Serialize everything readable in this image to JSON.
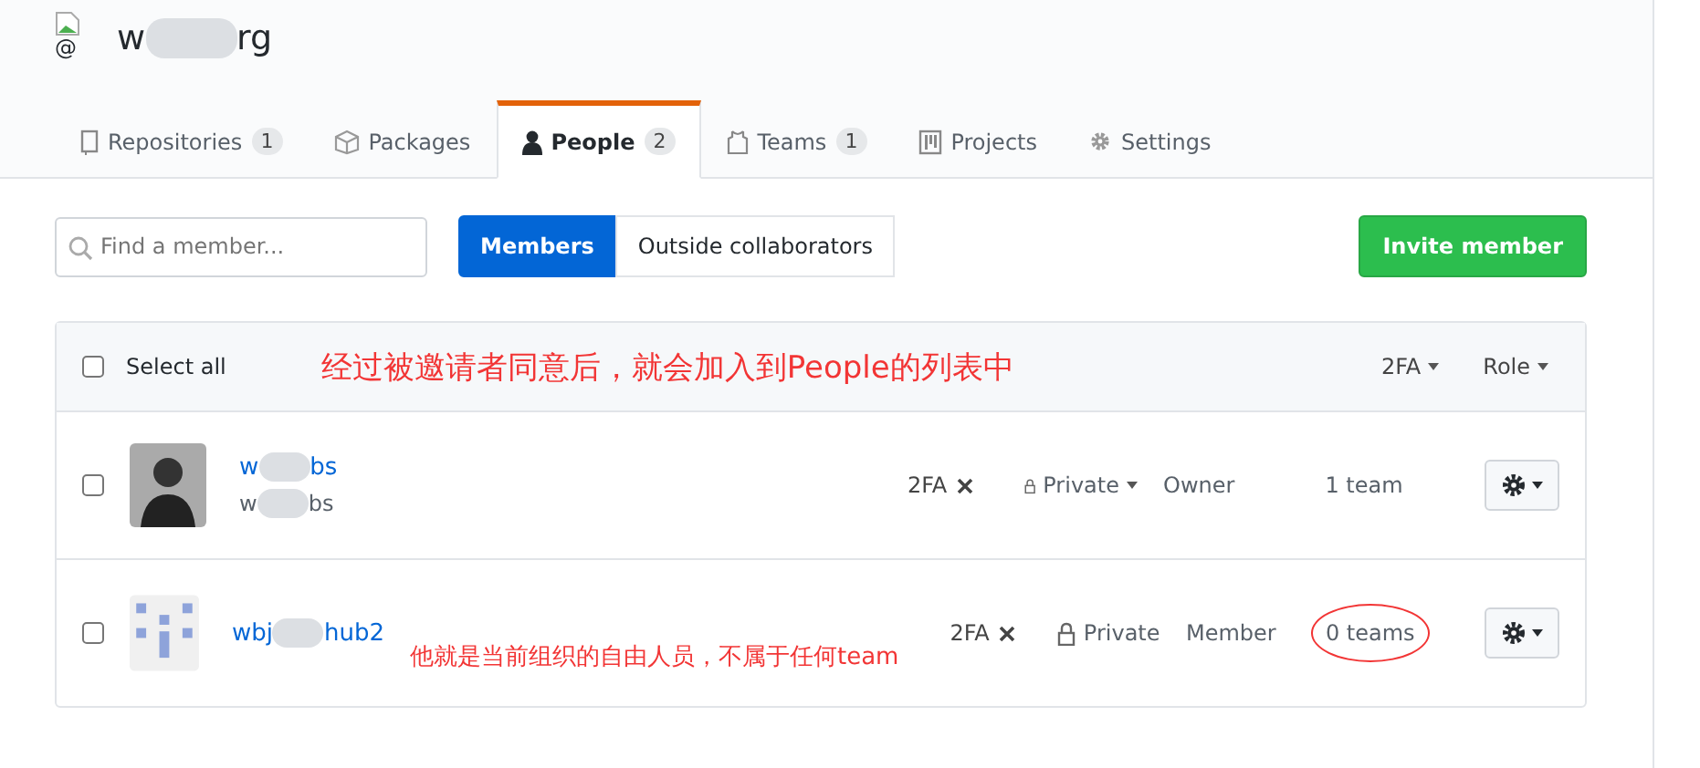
{
  "org": {
    "broken_image_alt": "@",
    "name_start": "w",
    "name_end": "rg"
  },
  "tabs": [
    {
      "kind": "repo",
      "label": "Repositories",
      "count": "1",
      "selected": false
    },
    {
      "kind": "package",
      "label": "Packages",
      "selected": false
    },
    {
      "kind": "person",
      "label": "People",
      "count": "2",
      "selected": true
    },
    {
      "kind": "team",
      "label": "Teams",
      "count": "1",
      "selected": false
    },
    {
      "kind": "project",
      "label": "Projects",
      "selected": false
    },
    {
      "kind": "gear",
      "label": "Settings",
      "selected": false
    }
  ],
  "search": {
    "placeholder": "Find a member..."
  },
  "filters": [
    {
      "label": "Members",
      "selected": true
    },
    {
      "label": "Outside collaborators",
      "selected": false
    }
  ],
  "invite_button": "Invite member",
  "table_header": {
    "select_all": "Select all",
    "checked": false,
    "annotation": "经过被邀请者同意后，就会加入到People的列表中",
    "twofa": "2FA",
    "role": "Role"
  },
  "members": [
    {
      "kind": "person",
      "name_start": "w",
      "name_end": "bs",
      "login_start": "w",
      "login_end": "bs",
      "checked": false,
      "twofa": "2FA",
      "visibility": "Private",
      "visibility_menu": true,
      "role": "Owner",
      "teams": "1 team",
      "circled": false
    },
    {
      "kind": "pattern",
      "name_start": "wbj",
      "name_end": "hub2",
      "checked": false,
      "twofa": "2FA",
      "visibility": "Private",
      "visibility_menu": false,
      "role": "Member",
      "teams": "0 teams",
      "circled": true,
      "annotation": "他就是当前组织的自由人员，不属于任何team"
    }
  ]
}
